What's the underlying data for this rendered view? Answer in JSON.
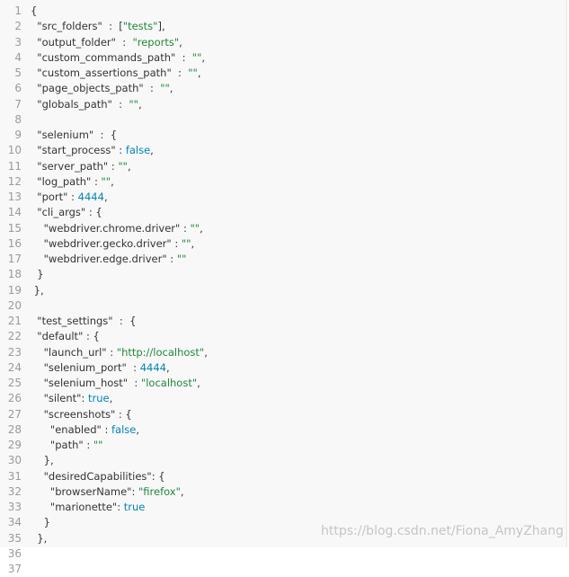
{
  "editor": {
    "line_numbers": [
      "1",
      "2",
      "3",
      "4",
      "5",
      "6",
      "7",
      "8",
      "9",
      "10",
      "11",
      "12",
      "13",
      "14",
      "15",
      "16",
      "17",
      "18",
      "19",
      "20",
      "21",
      "22",
      "23",
      "24",
      "25",
      "26",
      "27",
      "28",
      "29",
      "30",
      "31",
      "32",
      "33",
      "34",
      "35",
      "36",
      "37"
    ],
    "lines": [
      [
        {
          "t": "{",
          "c": "punc"
        }
      ],
      [
        {
          "t": "  \"src_folders\"",
          "c": "key"
        },
        {
          "t": "  :  [",
          "c": "punc"
        },
        {
          "t": "\"tests\"",
          "c": "str"
        },
        {
          "t": "],",
          "c": "punc"
        }
      ],
      [
        {
          "t": "  \"output_folder\"",
          "c": "key"
        },
        {
          "t": "  :  ",
          "c": "punc"
        },
        {
          "t": "\"reports\"",
          "c": "str"
        },
        {
          "t": ",",
          "c": "punc"
        }
      ],
      [
        {
          "t": "  \"custom_commands_path\"",
          "c": "key"
        },
        {
          "t": "  :  ",
          "c": "punc"
        },
        {
          "t": "\"\"",
          "c": "str"
        },
        {
          "t": ",",
          "c": "punc"
        }
      ],
      [
        {
          "t": "  \"custom_assertions_path\"",
          "c": "key"
        },
        {
          "t": "  :  ",
          "c": "punc"
        },
        {
          "t": "\"\"",
          "c": "str"
        },
        {
          "t": ",",
          "c": "punc"
        }
      ],
      [
        {
          "t": "  \"page_objects_path\"",
          "c": "key"
        },
        {
          "t": "  :  ",
          "c": "punc"
        },
        {
          "t": "\"\"",
          "c": "str"
        },
        {
          "t": ",",
          "c": "punc"
        }
      ],
      [
        {
          "t": "  \"globals_path\"",
          "c": "key"
        },
        {
          "t": "  :  ",
          "c": "punc"
        },
        {
          "t": "\"\"",
          "c": "str"
        },
        {
          "t": ",",
          "c": "punc"
        }
      ],
      [
        {
          "t": "",
          "c": "punc"
        }
      ],
      [
        {
          "t": "  \"selenium\"",
          "c": "key"
        },
        {
          "t": "  :  {",
          "c": "punc"
        }
      ],
      [
        {
          "t": "  \"start_process\"",
          "c": "key"
        },
        {
          "t": " : ",
          "c": "punc"
        },
        {
          "t": "false",
          "c": "lit"
        },
        {
          "t": ",",
          "c": "punc"
        }
      ],
      [
        {
          "t": "  \"server_path\"",
          "c": "key"
        },
        {
          "t": " : ",
          "c": "punc"
        },
        {
          "t": "\"\"",
          "c": "str"
        },
        {
          "t": ",",
          "c": "punc"
        }
      ],
      [
        {
          "t": "  \"log_path\"",
          "c": "key"
        },
        {
          "t": " : ",
          "c": "punc"
        },
        {
          "t": "\"\"",
          "c": "str"
        },
        {
          "t": ",",
          "c": "punc"
        }
      ],
      [
        {
          "t": "  \"port\"",
          "c": "key"
        },
        {
          "t": " : ",
          "c": "punc"
        },
        {
          "t": "4444",
          "c": "lit"
        },
        {
          "t": ",",
          "c": "punc"
        }
      ],
      [
        {
          "t": "  \"cli_args\"",
          "c": "key"
        },
        {
          "t": " : {",
          "c": "punc"
        }
      ],
      [
        {
          "t": "    \"webdriver.chrome.driver\"",
          "c": "key"
        },
        {
          "t": " : ",
          "c": "punc"
        },
        {
          "t": "\"\"",
          "c": "str"
        },
        {
          "t": ",",
          "c": "punc"
        }
      ],
      [
        {
          "t": "    \"webdriver.gecko.driver\"",
          "c": "key"
        },
        {
          "t": " : ",
          "c": "punc"
        },
        {
          "t": "\"\"",
          "c": "str"
        },
        {
          "t": ",",
          "c": "punc"
        }
      ],
      [
        {
          "t": "    \"webdriver.edge.driver\"",
          "c": "key"
        },
        {
          "t": " : ",
          "c": "punc"
        },
        {
          "t": "\"\"",
          "c": "str"
        }
      ],
      [
        {
          "t": "  }",
          "c": "punc"
        }
      ],
      [
        {
          "t": " },",
          "c": "punc"
        }
      ],
      [
        {
          "t": "",
          "c": "punc"
        }
      ],
      [
        {
          "t": "  \"test_settings\"",
          "c": "key"
        },
        {
          "t": "  :  {",
          "c": "punc"
        }
      ],
      [
        {
          "t": "  \"default\"",
          "c": "key"
        },
        {
          "t": " : {",
          "c": "punc"
        }
      ],
      [
        {
          "t": "    \"launch_url\"",
          "c": "key"
        },
        {
          "t": " : ",
          "c": "punc"
        },
        {
          "t": "\"http://localhost\"",
          "c": "str"
        },
        {
          "t": ",",
          "c": "punc"
        }
      ],
      [
        {
          "t": "    \"selenium_port\"",
          "c": "key"
        },
        {
          "t": "  : ",
          "c": "punc"
        },
        {
          "t": "4444",
          "c": "lit"
        },
        {
          "t": ",",
          "c": "punc"
        }
      ],
      [
        {
          "t": "    \"selenium_host\"",
          "c": "key"
        },
        {
          "t": "  : ",
          "c": "punc"
        },
        {
          "t": "\"localhost\"",
          "c": "str"
        },
        {
          "t": ",",
          "c": "punc"
        }
      ],
      [
        {
          "t": "    \"silent\"",
          "c": "key"
        },
        {
          "t": ": ",
          "c": "punc"
        },
        {
          "t": "true",
          "c": "lit"
        },
        {
          "t": ",",
          "c": "punc"
        }
      ],
      [
        {
          "t": "    \"screenshots\"",
          "c": "key"
        },
        {
          "t": " : {",
          "c": "punc"
        }
      ],
      [
        {
          "t": "      \"enabled\"",
          "c": "key"
        },
        {
          "t": " : ",
          "c": "punc"
        },
        {
          "t": "false",
          "c": "lit"
        },
        {
          "t": ",",
          "c": "punc"
        }
      ],
      [
        {
          "t": "      \"path\"",
          "c": "key"
        },
        {
          "t": " : ",
          "c": "punc"
        },
        {
          "t": "\"\"",
          "c": "str"
        }
      ],
      [
        {
          "t": "    },",
          "c": "punc"
        }
      ],
      [
        {
          "t": "    \"desiredCapabilities\"",
          "c": "key"
        },
        {
          "t": ": {",
          "c": "punc"
        }
      ],
      [
        {
          "t": "      \"browserName\"",
          "c": "key"
        },
        {
          "t": ": ",
          "c": "punc"
        },
        {
          "t": "\"firefox\"",
          "c": "str"
        },
        {
          "t": ",",
          "c": "punc"
        }
      ],
      [
        {
          "t": "      \"marionette\"",
          "c": "key"
        },
        {
          "t": ": ",
          "c": "punc"
        },
        {
          "t": "true",
          "c": "lit"
        }
      ],
      [
        {
          "t": "    }",
          "c": "punc"
        }
      ],
      [
        {
          "t": "  },",
          "c": "punc"
        }
      ],
      [
        {
          "t": "",
          "c": "punc"
        }
      ],
      [
        {
          "t": "",
          "c": "punc"
        }
      ]
    ]
  },
  "watermark": "https://blog.csdn.net/Fiona_AmyZhang",
  "colors": {
    "background": "#f8f8f8",
    "line_number": "#9a9a9a",
    "string": "#22863a",
    "literal": "#0086b3",
    "text": "#333333"
  }
}
